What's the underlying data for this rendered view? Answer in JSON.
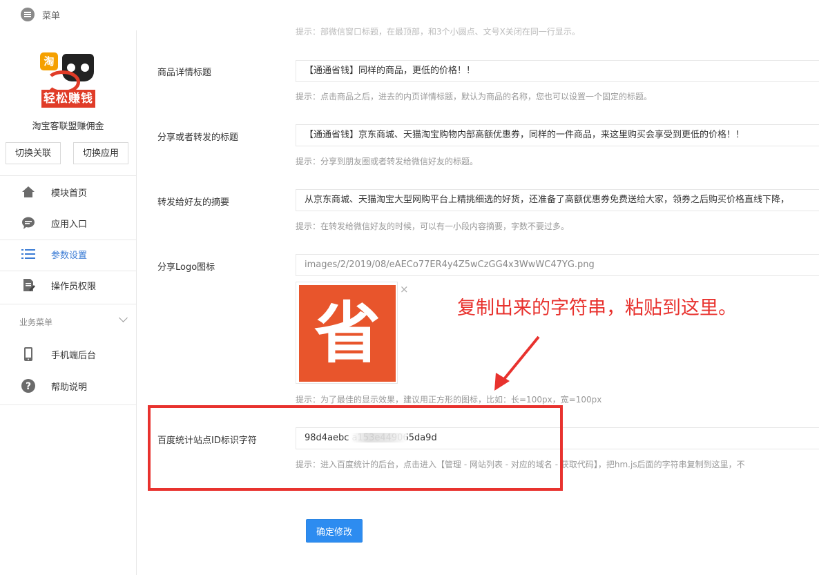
{
  "topbar": {
    "menu_label": "菜单"
  },
  "sidebar": {
    "app_name": "淘宝客联盟赚佣金",
    "logo": {
      "badge": "淘",
      "band_text": "轻松赚钱"
    },
    "switch_relation": "切换关联",
    "switch_app": "切换应用",
    "items": [
      {
        "label": "模块首页",
        "icon": "home-icon"
      },
      {
        "label": "应用入口",
        "icon": "chat-icon"
      },
      {
        "label": "参数设置",
        "icon": "list-icon",
        "active": true
      },
      {
        "label": "操作员权限",
        "icon": "document-edit-icon"
      }
    ],
    "business_group": "业务菜单",
    "business_items": [
      {
        "label": "手机端后台",
        "icon": "phone-icon"
      },
      {
        "label": "帮助说明",
        "icon": "help-icon"
      }
    ]
  },
  "form": {
    "top_hint": "提示：部微信窗口标题，在最顶部，和3个小圆点、文号X关闭在同一行显示。",
    "detail_title": {
      "label": "商品详情标题",
      "value": "【通通省钱】同样的商品，更低的价格！！",
      "hint": "提示：点击商品之后，进去的内页详情标题，默认为商品的名称，您也可以设置一个固定的标题。"
    },
    "share_title": {
      "label": "分享或者转发的标题",
      "value": "【通通省钱】京东商城、天猫淘宝购物内部高额优惠券，同样的一件商品，来这里购买会享受到更低的价格！！",
      "hint": "提示：分享到朋友圈或者转发给微信好友的标题。"
    },
    "summary": {
      "label": "转发给好友的摘要",
      "value": "从京东商城、天猫淘宝大型网购平台上精挑细选的好货，还准备了高额优惠券免费送给大家，领券之后购买价格直线下降，",
      "hint": "提示：在转发给微信好友的时候，可以有一小段内容摘要，字数不要过多。"
    },
    "share_logo": {
      "label": "分享Logo图标",
      "value": "images/2/2019/08/eAECo77ER4y4Z5wCzGG4x3WwWC47YG.png",
      "preview_glyph": "省",
      "close": "×",
      "hint": "提示：为了最佳的显示效果，建议用正方形的图标，比如：长=100px，宽=100px"
    },
    "baidu_id": {
      "label": "百度统计站点ID标识字符",
      "value": "98d4aebc        a153e449065da9d",
      "hint": "提示：进入百度统计的后台，点击进入【管理 - 网站列表 - 对应的域名 - 获取代码】，把hm.js后面的字符串复制到这里，不"
    },
    "submit": "确定修改"
  },
  "annotation": {
    "text": "复制出来的字符串，粘贴到这里。",
    "color": "#e8322e"
  },
  "colors": {
    "accent": "#2d8cf0",
    "active_nav": "#3a7bd5",
    "annotation": "#e8322e",
    "logo_tile": "#e8552c"
  }
}
